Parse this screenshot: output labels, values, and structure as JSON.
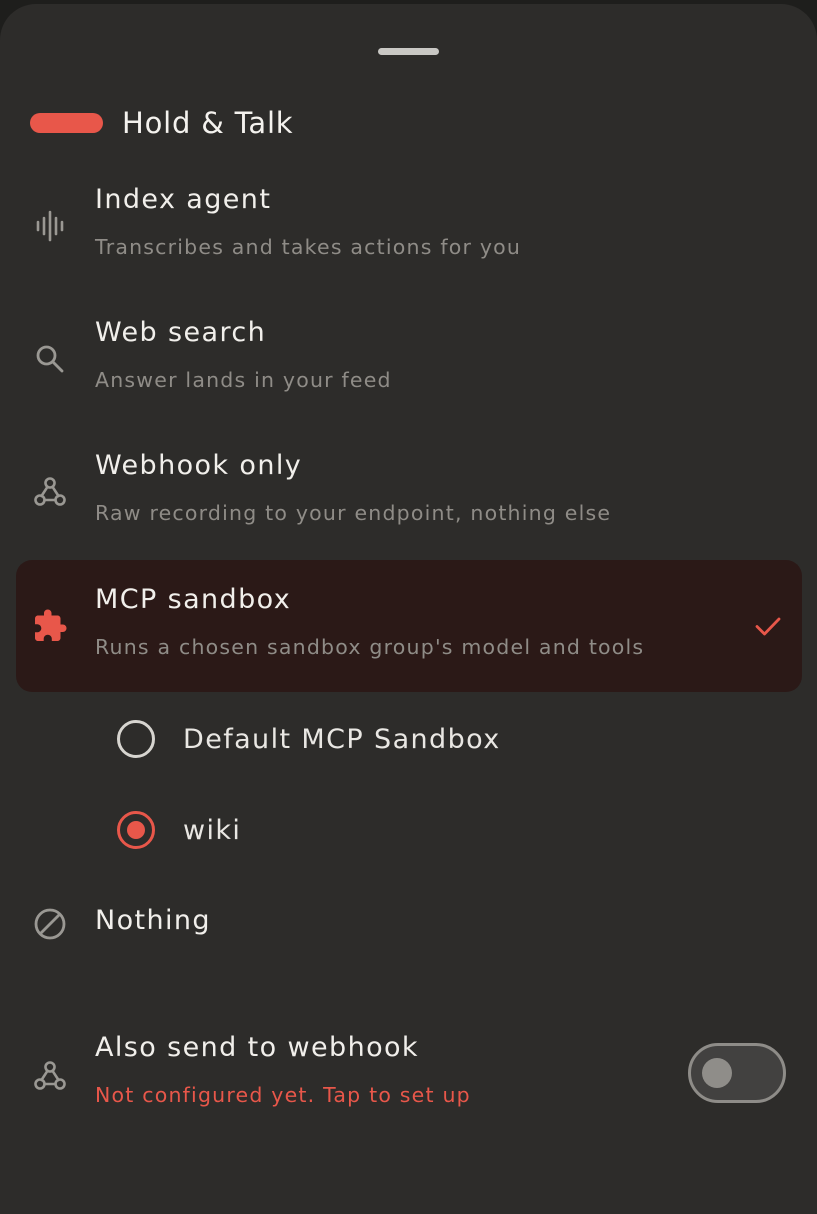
{
  "header": {
    "title": "Hold & Talk"
  },
  "options": [
    {
      "title": "Index agent",
      "subtitle": "Transcribes and takes actions for you",
      "icon": "waveform-icon"
    },
    {
      "title": "Web search",
      "subtitle": "Answer lands in your feed",
      "icon": "search-icon"
    },
    {
      "title": "Webhook only",
      "subtitle": "Raw recording to your endpoint, nothing else",
      "icon": "webhook-icon"
    },
    {
      "title": "MCP sandbox",
      "subtitle": "Runs a chosen sandbox group's model and tools",
      "icon": "puzzle-icon",
      "selected": true
    }
  ],
  "sandboxes": [
    {
      "label": "Default MCP Sandbox",
      "selected": false
    },
    {
      "label": "wiki",
      "selected": true
    }
  ],
  "nothing": {
    "label": "Nothing",
    "icon": "prohibited-icon"
  },
  "webhook": {
    "title": "Also send to webhook",
    "subtitle": "Not configured yet. Tap to set up",
    "icon": "webhook-icon",
    "enabled": false
  },
  "colors": {
    "accent": "#e8574a",
    "background": "#2d2c2a",
    "selected_background": "#2b1917",
    "text_primary": "#f1efeb",
    "text_secondary": "#8f8c87"
  }
}
